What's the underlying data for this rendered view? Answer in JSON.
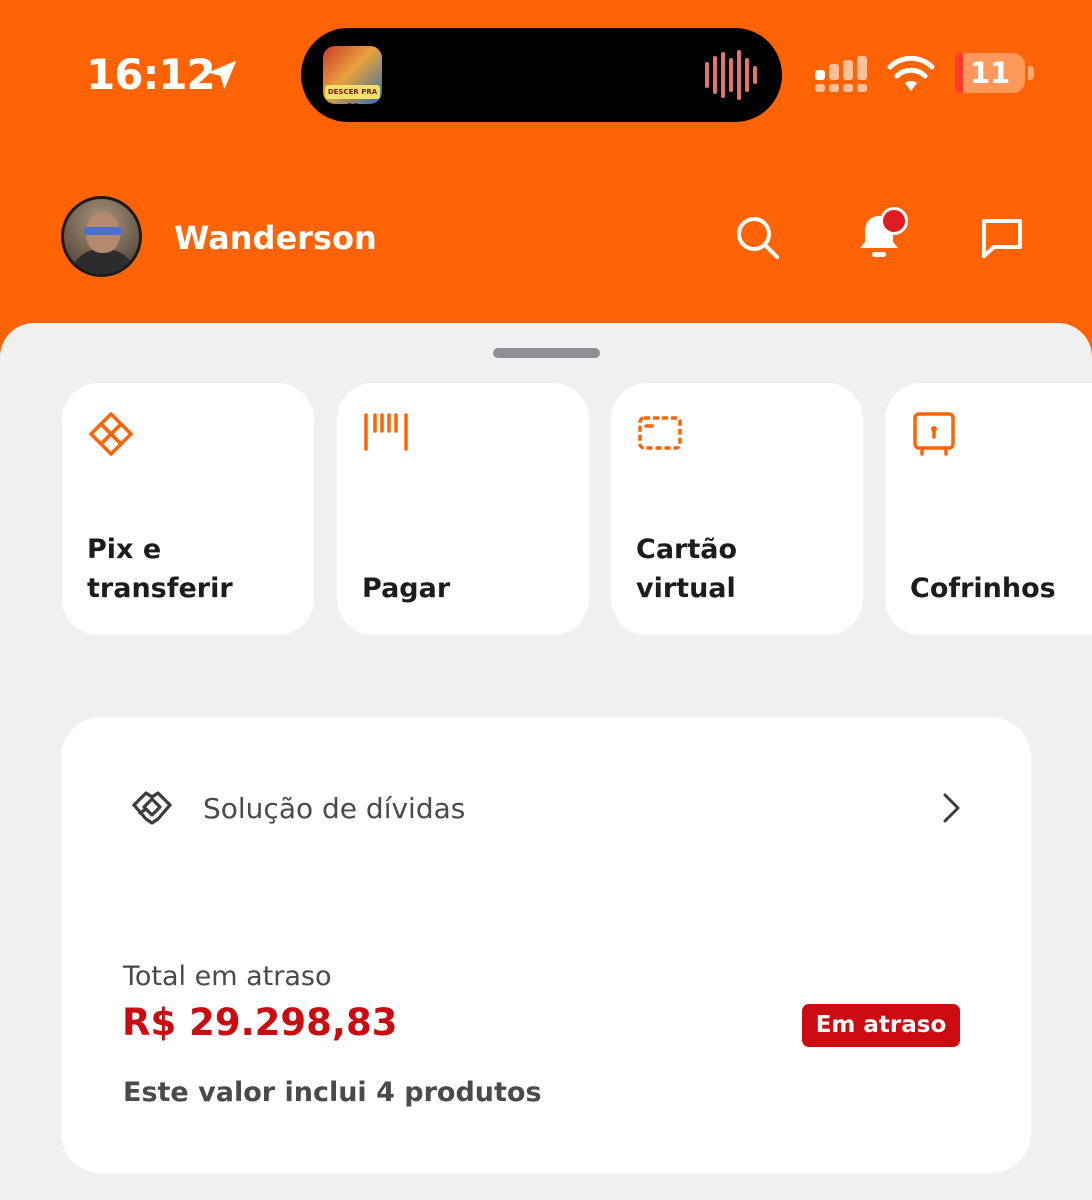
{
  "colors": {
    "brand": "#ff6304",
    "background": "#f0f0f2",
    "card": "#ffffff",
    "alert_red": "#cc0a12",
    "notification_dot": "#e11b22",
    "battery_low": "#ff3b30"
  },
  "status_bar": {
    "time": "16:12",
    "battery_level": "11",
    "battery_fraction": 0.11,
    "now_playing_art_text": "DESCER PRA BC",
    "icons": [
      "location-arrow-icon",
      "audio-waveform-icon",
      "cellular-signal-icon",
      "wifi-icon",
      "battery-icon"
    ]
  },
  "header": {
    "user_name": "Wanderson",
    "icons": [
      "search-icon",
      "bell-icon",
      "chat-icon"
    ],
    "notifications_unread": true
  },
  "shortcuts": [
    {
      "label": "Pix e transferir",
      "icon": "pix-icon"
    },
    {
      "label": "Pagar",
      "icon": "barcode-icon"
    },
    {
      "label": "Cartão virtual",
      "icon": "virtual-card-icon"
    },
    {
      "label": "Cofrinhos",
      "icon": "safe-icon"
    }
  ],
  "debt_card": {
    "title": "Solução de dívidas",
    "icon": "handshake-icon",
    "overdue_label": "Total em atraso",
    "overdue_value": "R$ 29.298,83",
    "status_badge": "Em atraso",
    "products_note": "Este valor inclui 4 produtos"
  }
}
